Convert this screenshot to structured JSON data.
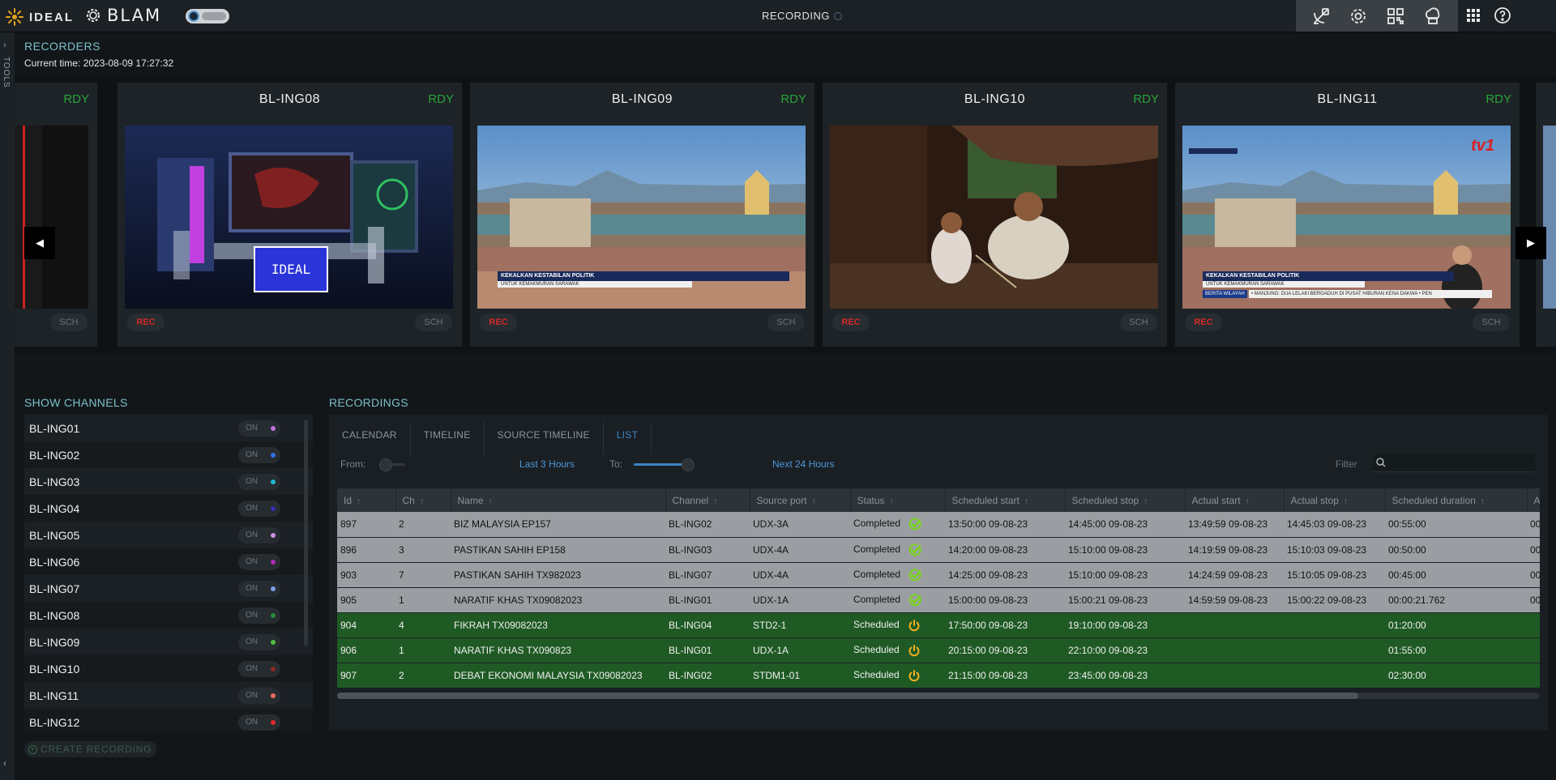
{
  "header": {
    "brand_ideal": "IDEAL",
    "brand_blam": "BLAM",
    "page_title": "RECORDING"
  },
  "rail": {
    "label": "TOOLS"
  },
  "recorders": {
    "title": "RECORDERS",
    "current_time": "Current time: 2023-08-09 17:27:32",
    "cards": [
      {
        "name": "",
        "status": "RDY",
        "rec": "",
        "sch": "SCH"
      },
      {
        "name": "BL-ING08",
        "status": "RDY",
        "rec": "REC",
        "sch": "SCH"
      },
      {
        "name": "BL-ING09",
        "status": "RDY",
        "rec": "REC",
        "sch": "SCH"
      },
      {
        "name": "BL-ING10",
        "status": "RDY",
        "rec": "REC",
        "sch": "SCH"
      },
      {
        "name": "BL-ING11",
        "status": "RDY",
        "rec": "REC",
        "sch": "SCH"
      }
    ],
    "overlay_texts": {
      "headline": "KEKALKAN KESTABILAN POLITIK",
      "subline": "UNTUK KEMAKMURAN SARAWAK",
      "ticker_left": "BERITA WILAYAH",
      "ticker_text": "• MANJUNG: DUA LELAKI BERGADUH DI PUSAT HIBURAN KENA DAKWA  • PEN",
      "channel_logo": "tv1"
    },
    "prev_arrow": "◀",
    "next_arrow": "▶"
  },
  "channels": {
    "title": "SHOW CHANNELS",
    "items": [
      {
        "name": "BL-ING01",
        "state": "ON",
        "color": "#c070e0"
      },
      {
        "name": "BL-ING02",
        "state": "ON",
        "color": "#2f6fe0"
      },
      {
        "name": "BL-ING03",
        "state": "ON",
        "color": "#1fb8d0"
      },
      {
        "name": "BL-ING04",
        "state": "ON",
        "color": "#3a2ab0"
      },
      {
        "name": "BL-ING05",
        "state": "ON",
        "color": "#d090e8"
      },
      {
        "name": "BL-ING06",
        "state": "ON",
        "color": "#b02ab8"
      },
      {
        "name": "BL-ING07",
        "state": "ON",
        "color": "#7aa0e8"
      },
      {
        "name": "BL-ING08",
        "state": "ON",
        "color": "#2a8a3a"
      },
      {
        "name": "BL-ING09",
        "state": "ON",
        "color": "#4fc040"
      },
      {
        "name": "BL-ING10",
        "state": "ON",
        "color": "#8a2a22"
      },
      {
        "name": "BL-ING11",
        "state": "ON",
        "color": "#f06a60"
      },
      {
        "name": "BL-ING12",
        "state": "ON",
        "color": "#e02a2a"
      }
    ],
    "create_label": "CREATE RECORDING"
  },
  "recordings": {
    "title": "RECORDINGS",
    "tabs": [
      "CALENDAR",
      "TIMELINE",
      "SOURCE TIMELINE",
      "LIST"
    ],
    "active_tab": 3,
    "from_label": "From:",
    "from_link": "Last 3 Hours",
    "to_label": "To:",
    "to_link": "Next 24 Hours",
    "from_slider_value": 0.05,
    "to_slider_value": 0.95,
    "filter_label": "Filter",
    "filter_value": "",
    "columns": [
      "Id",
      "Ch",
      "Name",
      "Channel",
      "Source port",
      "Status",
      "Scheduled start",
      "Scheduled stop",
      "Actual start",
      "Actual stop",
      "Scheduled duration",
      "Ac"
    ],
    "rows": [
      {
        "id": "897",
        "ch": "2",
        "name": "BIZ MALAYSIA EP157",
        "channel": "BL-ING02",
        "port": "UDX-3A",
        "status": "Completed",
        "sstart": "13:50:00 09-08-23",
        "sstop": "14:45:00 09-08-23",
        "astart": "13:49:59 09-08-23",
        "astop": "14:45:03 09-08-23",
        "dur": "00:55:00",
        "ac": "00"
      },
      {
        "id": "896",
        "ch": "3",
        "name": "PASTIKAN SAHIH EP158",
        "channel": "BL-ING03",
        "port": "UDX-4A",
        "status": "Completed",
        "sstart": "14:20:00 09-08-23",
        "sstop": "15:10:00 09-08-23",
        "astart": "14:19:59 09-08-23",
        "astop": "15:10:03 09-08-23",
        "dur": "00:50:00",
        "ac": "00"
      },
      {
        "id": "903",
        "ch": "7",
        "name": "PASTIKAN SAHIH TX982023",
        "channel": "BL-ING07",
        "port": "UDX-4A",
        "status": "Completed",
        "sstart": "14:25:00 09-08-23",
        "sstop": "15:10:00 09-08-23",
        "astart": "14:24:59 09-08-23",
        "astop": "15:10:05 09-08-23",
        "dur": "00:45:00",
        "ac": "00"
      },
      {
        "id": "905",
        "ch": "1",
        "name": "NARATIF KHAS TX09082023",
        "channel": "BL-ING01",
        "port": "UDX-1A",
        "status": "Completed",
        "sstart": "15:00:00 09-08-23",
        "sstop": "15:00:21 09-08-23",
        "astart": "14:59:59 09-08-23",
        "astop": "15:00:22 09-08-23",
        "dur": "00:00:21.762",
        "ac": "00"
      },
      {
        "id": "904",
        "ch": "4",
        "name": "FIKRAH TX09082023",
        "channel": "BL-ING04",
        "port": "STD2-1",
        "status": "Scheduled",
        "sstart": "17:50:00 09-08-23",
        "sstop": "19:10:00 09-08-23",
        "astart": "",
        "astop": "",
        "dur": "01:20:00",
        "ac": ""
      },
      {
        "id": "906",
        "ch": "1",
        "name": "NARATIF KHAS TX090823",
        "channel": "BL-ING01",
        "port": "UDX-1A",
        "status": "Scheduled",
        "sstart": "20:15:00 09-08-23",
        "sstop": "22:10:00 09-08-23",
        "astart": "",
        "astop": "",
        "dur": "01:55:00",
        "ac": ""
      },
      {
        "id": "907",
        "ch": "2",
        "name": "DEBAT EKONOMI MALAYSIA TX09082023",
        "channel": "BL-ING02",
        "port": "STDM1-01",
        "status": "Scheduled",
        "sstart": "21:15:00 09-08-23",
        "sstop": "23:45:00 09-08-23",
        "astart": "",
        "astop": "",
        "dur": "02:30:00",
        "ac": ""
      }
    ],
    "status_icons": {
      "Completed": "check-circle-icon",
      "Scheduled": "power-icon"
    },
    "status_colors": {
      "completed_row": "#9a9ea2",
      "scheduled_row": "#1f5a24",
      "icon_green": "#7ad61a",
      "icon_amber": "#f0b020"
    }
  }
}
